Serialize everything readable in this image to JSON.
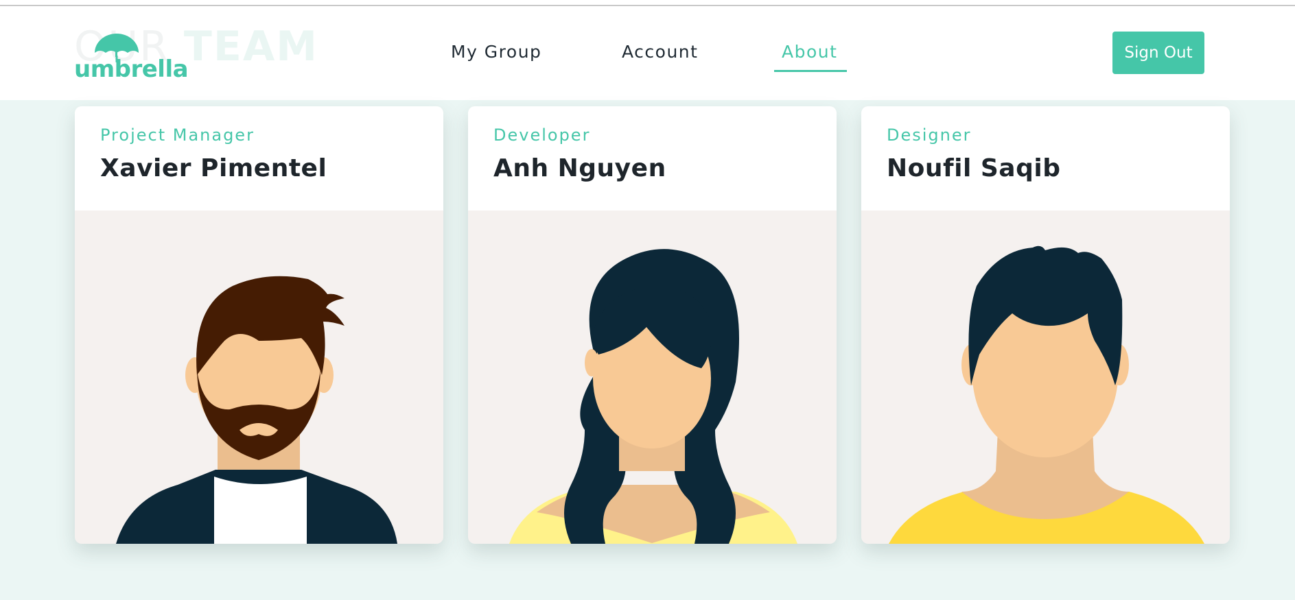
{
  "header": {
    "background_heading": {
      "light": "OUR",
      "bold": "TEAM"
    },
    "logo_text": "umbrella",
    "nav": [
      {
        "label": "My Group",
        "active": false
      },
      {
        "label": "Account",
        "active": false
      },
      {
        "label": "About",
        "active": true
      }
    ],
    "sign_out_label": "Sign Out"
  },
  "team": [
    {
      "role": "Project Manager",
      "name": "Xavier Pimentel",
      "avatar": "bearded-man-avatar"
    },
    {
      "role": "Developer",
      "name": "Anh Nguyen",
      "avatar": "long-hair-woman-avatar"
    },
    {
      "role": "Designer",
      "name": "Noufil Saqib",
      "avatar": "short-hair-man-avatar"
    }
  ],
  "colors": {
    "accent": "#45c6a8",
    "page_background": "#ebf6f4",
    "avatar_background": "#f5f1ef",
    "skin": "#f8c995",
    "hair_dark": "#0c2838",
    "hair_brown": "#451c03",
    "shirt_yellow": "#fed93d"
  }
}
